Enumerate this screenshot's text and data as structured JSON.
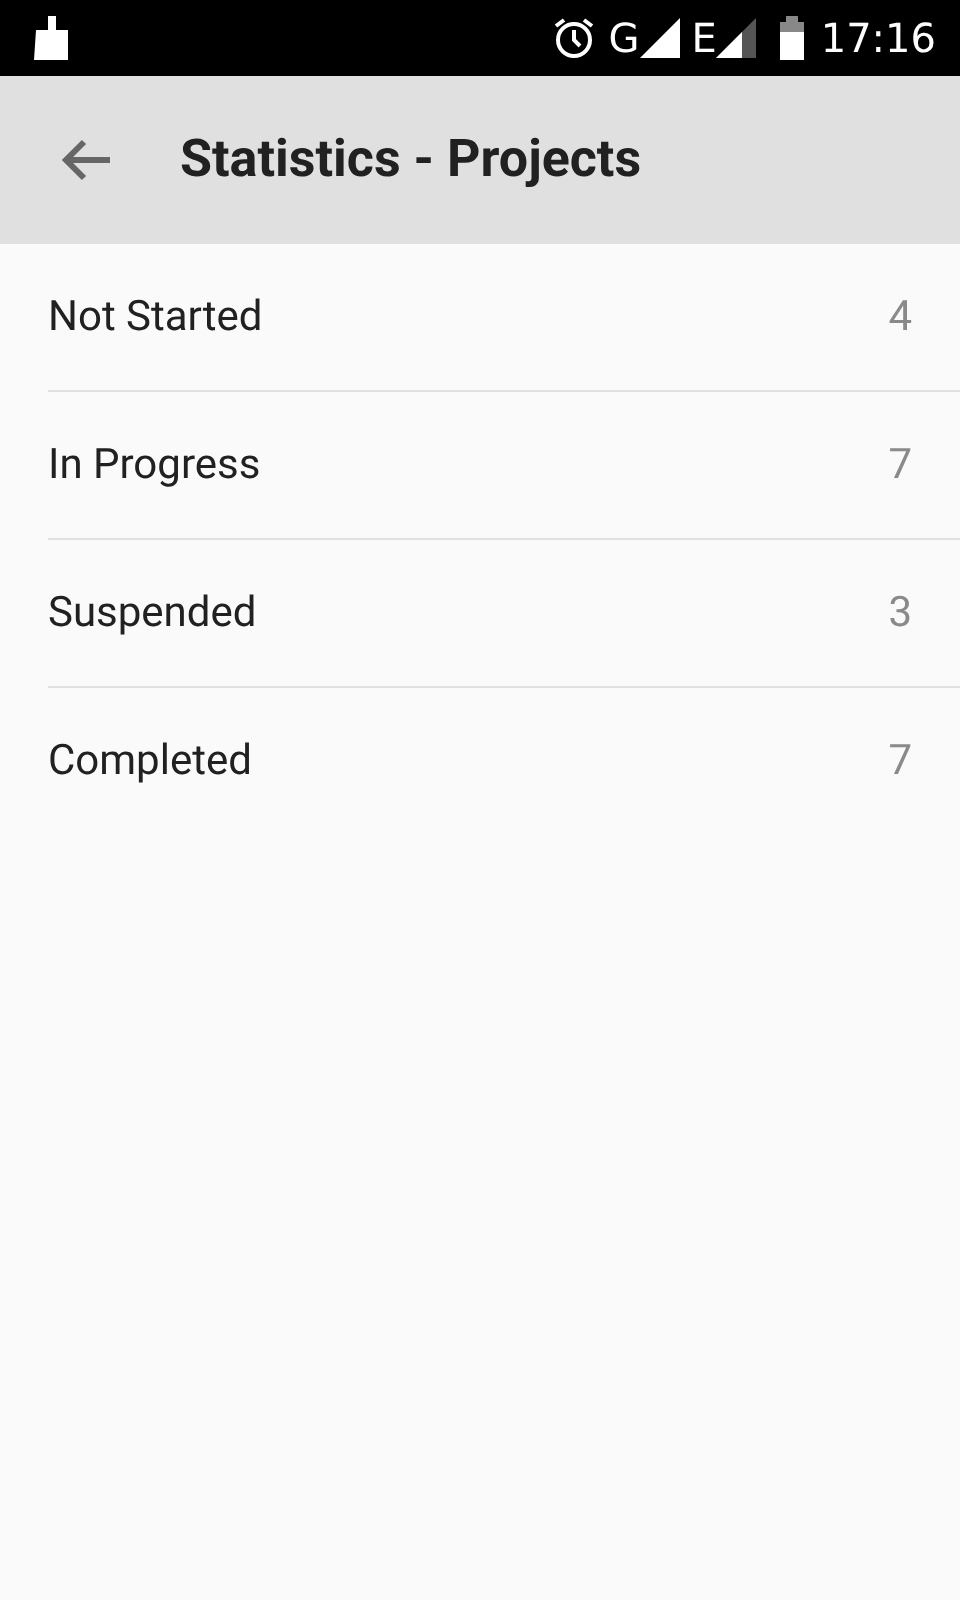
{
  "status_bar": {
    "network_1": "G",
    "network_2": "E",
    "time": "17:16"
  },
  "app_bar": {
    "title": "Statistics - Projects"
  },
  "rows": [
    {
      "label": "Not Started",
      "count": "4"
    },
    {
      "label": "In Progress",
      "count": "7"
    },
    {
      "label": "Suspended",
      "count": "3"
    },
    {
      "label": "Completed",
      "count": "7"
    }
  ]
}
